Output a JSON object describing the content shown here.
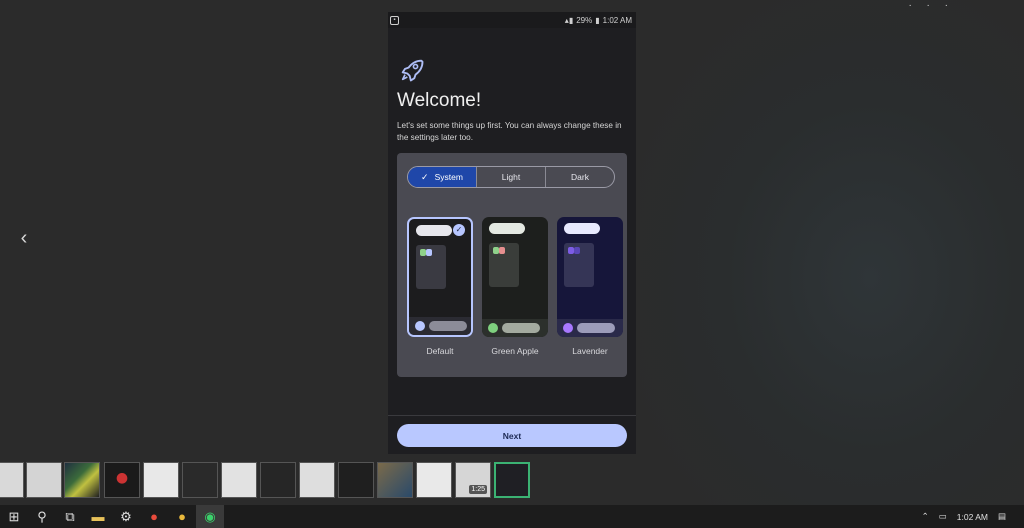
{
  "status_bar": {
    "battery": "29%",
    "time": "1:02 AM"
  },
  "onboarding": {
    "title": "Welcome!",
    "subtitle": "Let's set some things up first. You can always change these in the settings later too.",
    "theme_mode": {
      "options": [
        "System",
        "Light",
        "Dark"
      ],
      "selected": "System"
    },
    "themes": [
      {
        "name": "Default",
        "selected": true
      },
      {
        "name": "Green Apple",
        "selected": false
      },
      {
        "name": "Lavender",
        "selected": false
      }
    ],
    "next_label": "Next"
  },
  "thumbnail_strip": {
    "active_index": 12,
    "video_time": "1:25"
  },
  "taskbar": {
    "clock": "1:02 AM"
  },
  "colors": {
    "accent": "#b9c8ff",
    "segment_active": "#1f47a9",
    "thumb_active_border": "#3bb273"
  }
}
